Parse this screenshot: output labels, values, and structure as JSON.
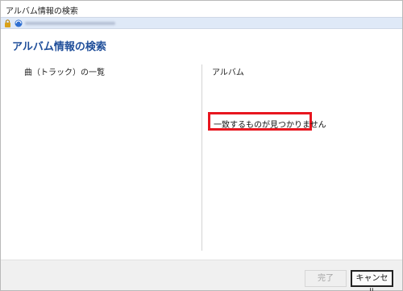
{
  "window": {
    "title": "アルバム情報の検索"
  },
  "addressbar": {
    "lock_icon": "lock-icon",
    "site_icon": "globe-icon"
  },
  "page": {
    "heading": "アルバム情報の検索"
  },
  "columns": {
    "tracks_header": "曲（トラック）の一覧",
    "album_header": "アルバム",
    "album_message": "一致するものが見つかりません"
  },
  "colors": {
    "heading": "#1f4e9a",
    "highlight_border": "#e8161f",
    "addressbar_bg": "#dfe9f7"
  },
  "footer": {
    "done_label": "完了",
    "done_enabled": false,
    "cancel_label": "キャンセル"
  }
}
